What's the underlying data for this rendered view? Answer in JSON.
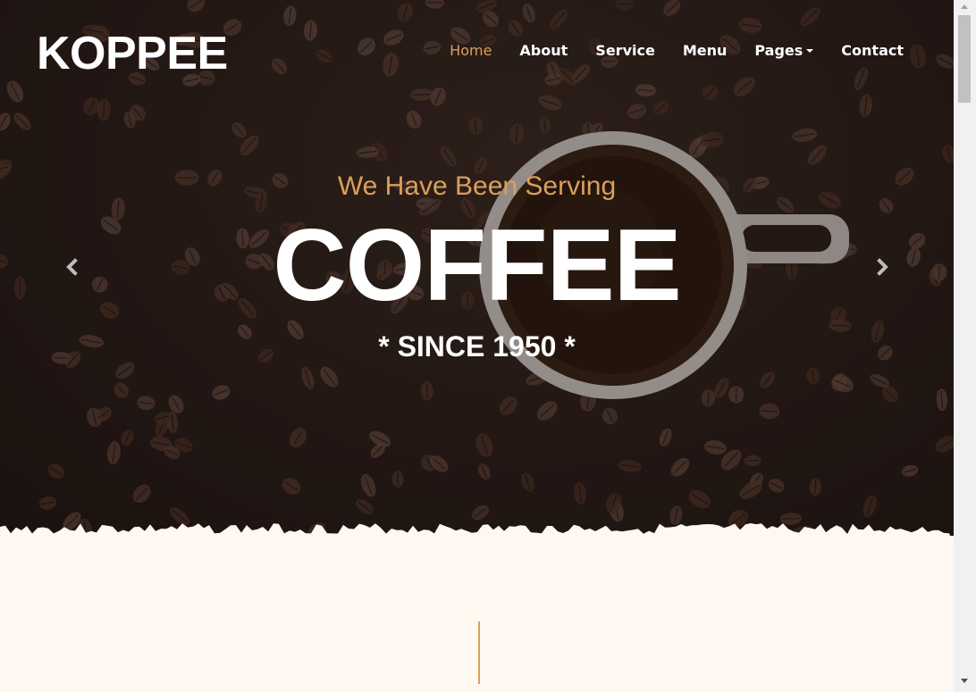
{
  "brand": {
    "name": "KOPPEE"
  },
  "nav": {
    "items": [
      {
        "label": "Home",
        "active": true
      },
      {
        "label": "About",
        "active": false
      },
      {
        "label": "Service",
        "active": false
      },
      {
        "label": "Menu",
        "active": false
      },
      {
        "label": "Pages",
        "active": false,
        "dropdown": true
      },
      {
        "label": "Contact",
        "active": false
      }
    ]
  },
  "hero": {
    "subtitle": "We Have Been Serving",
    "title": "COFFEE",
    "tagline": "* SINCE 1950 *",
    "controls": {
      "prev_icon": "chevron-left-icon",
      "next_icon": "chevron-right-icon"
    }
  },
  "colors": {
    "accent": "#da9f5b",
    "hero_dark": "#2a1e1a",
    "page_bg": "#fff8f0",
    "text_light": "#ffffff"
  }
}
